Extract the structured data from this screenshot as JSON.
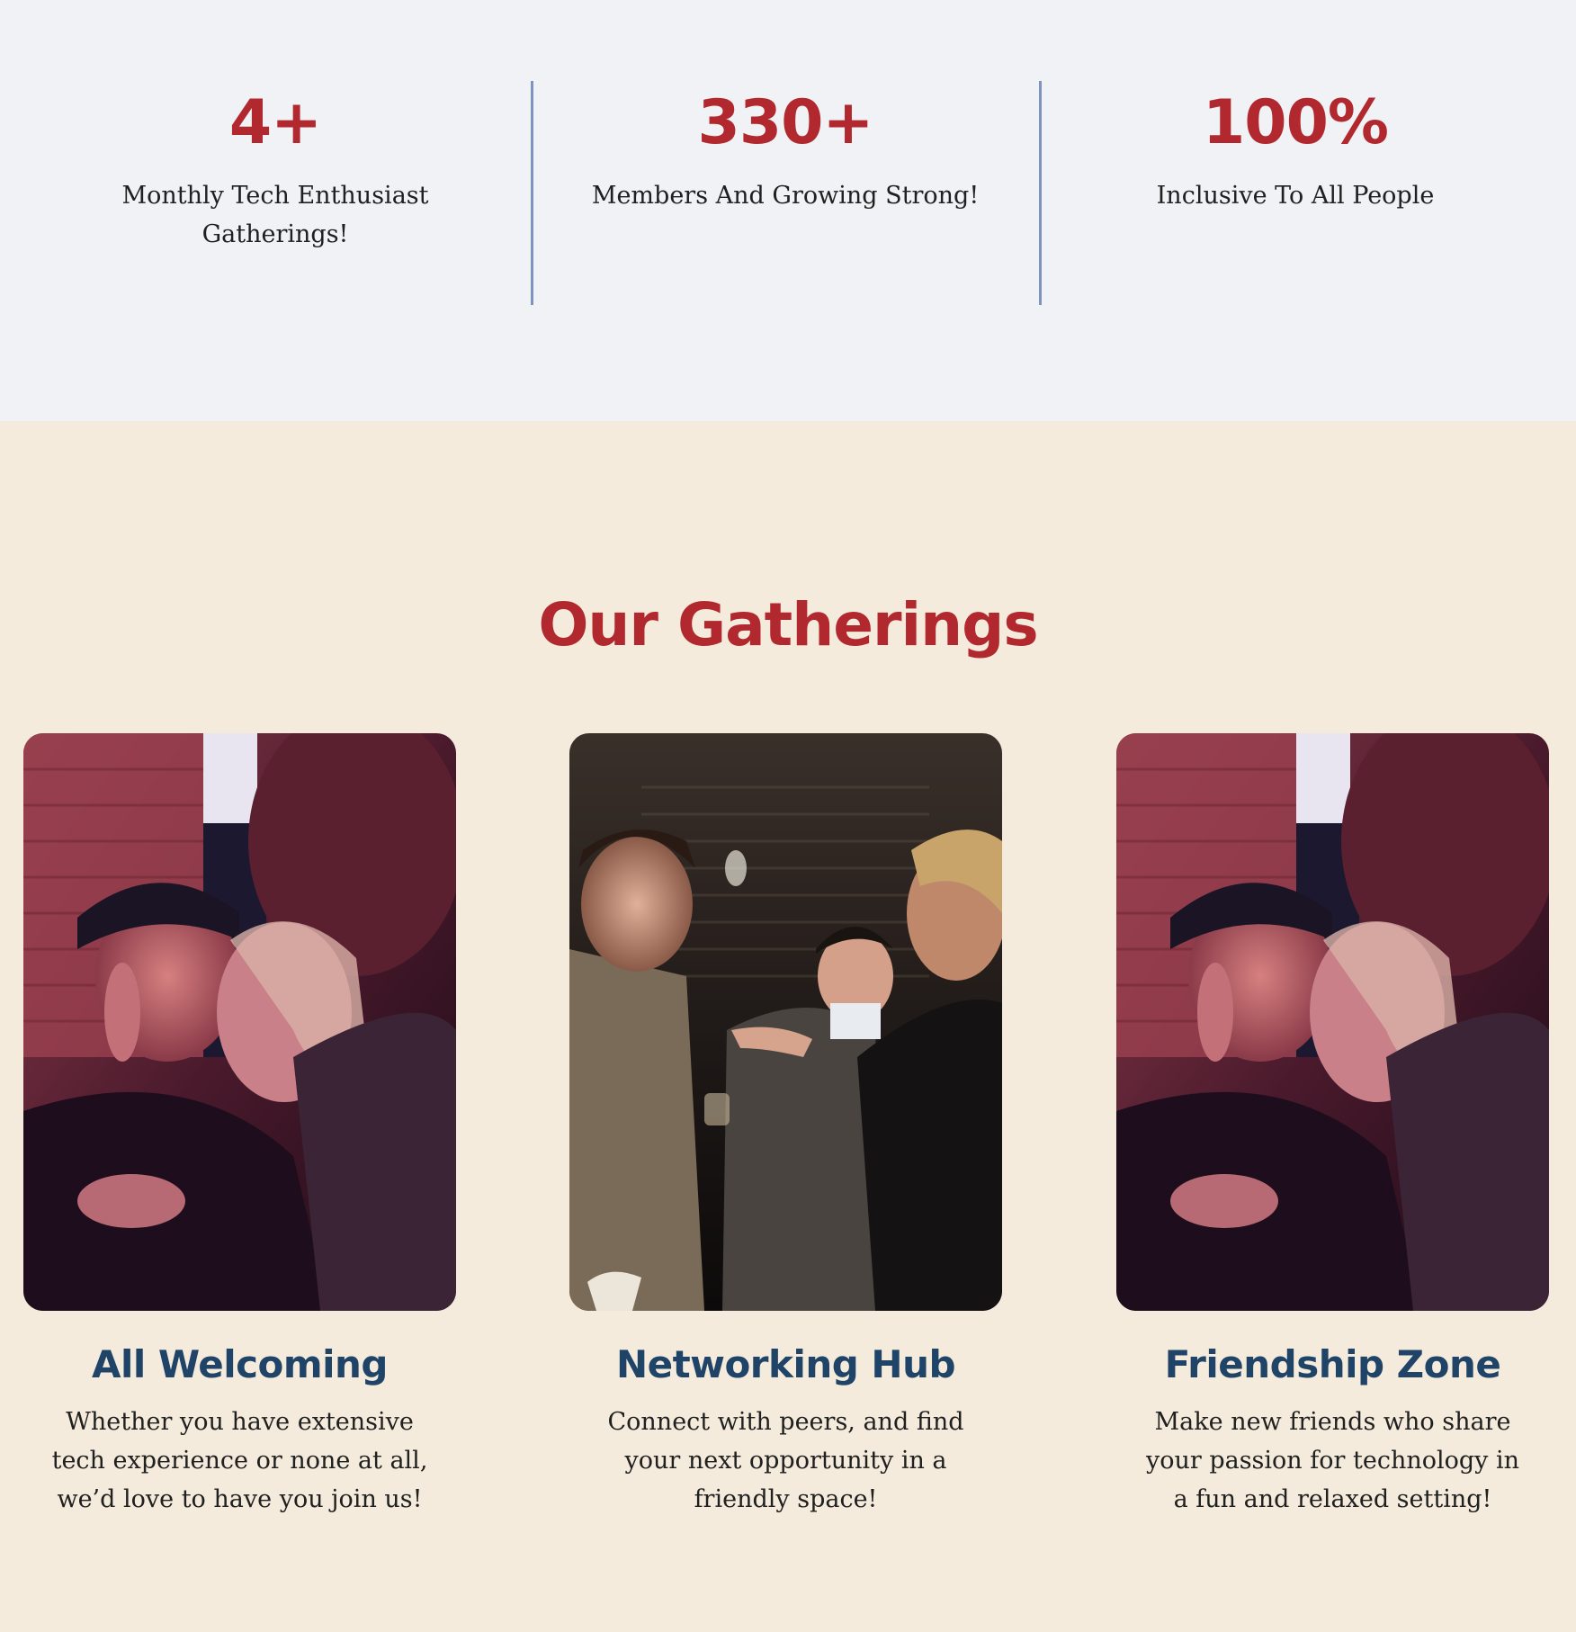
{
  "stats": [
    {
      "value": "4+",
      "label": "Monthly Tech Enthusiast Gatherings!"
    },
    {
      "value": "330+",
      "label": "Members And Growing Strong!"
    },
    {
      "value": "100%",
      "label": "Inclusive To All People"
    }
  ],
  "gatherings": {
    "title": "Our Gatherings",
    "cards": [
      {
        "title": "All Welcoming",
        "text": "Whether you have extensive tech experience or none at all, we’d love to have you join us!"
      },
      {
        "title": "Networking Hub",
        "text": "Connect with peers, and find your next opportunity in a friendly space!"
      },
      {
        "title": "Friendship Zone",
        "text": "Make new friends who share your passion for technology in a fun and relaxed setting!"
      }
    ]
  },
  "colors": {
    "stats_background": "#f1f2f5",
    "section_background": "#f4ebdc",
    "accent_red": "#b1282e",
    "heading_navy": "#1f4467",
    "divider_blue": "#7f93bf"
  }
}
